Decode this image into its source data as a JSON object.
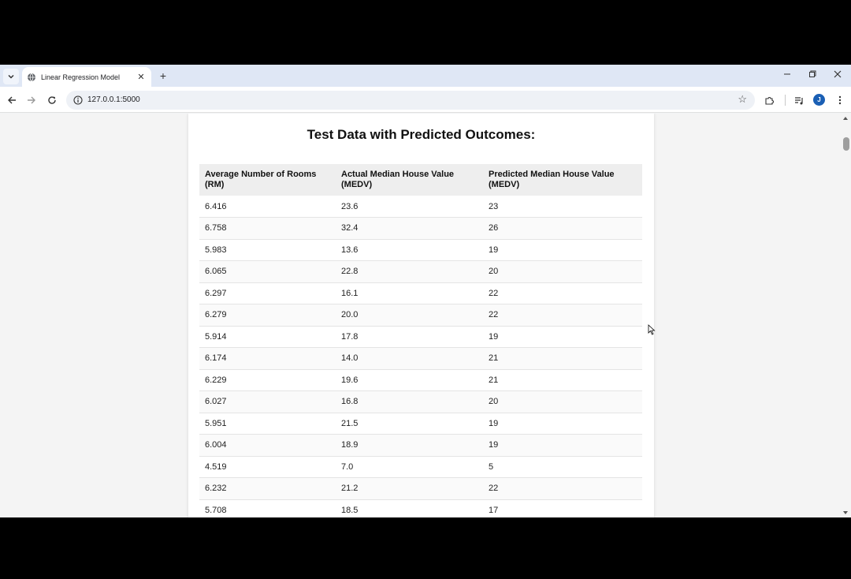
{
  "browser": {
    "tab_title": "Linear Regression Model",
    "url": "127.0.0.1:5000",
    "profile_initial": "J",
    "accent_color": "#1a5fb4"
  },
  "icons": {
    "tab_search": "chevron-down-icon",
    "new_tab": "plus-icon",
    "back": "arrow-left-icon",
    "forward": "arrow-right-icon",
    "reload": "reload-icon",
    "site_info": "info-icon",
    "bookmark": "star-icon",
    "extensions": "puzzle-icon",
    "media": "media-control-icon",
    "menu": "kebab-menu-icon"
  },
  "page": {
    "heading": "Test Data with Predicted Outcomes:",
    "table": {
      "headers": [
        "Average Number of Rooms (RM)",
        "Actual Median House Value (MEDV)",
        "Predicted Median House Value (MEDV)"
      ],
      "rows": [
        [
          "6.416",
          "23.6",
          "23"
        ],
        [
          "6.758",
          "32.4",
          "26"
        ],
        [
          "5.983",
          "13.6",
          "19"
        ],
        [
          "6.065",
          "22.8",
          "20"
        ],
        [
          "6.297",
          "16.1",
          "22"
        ],
        [
          "6.279",
          "20.0",
          "22"
        ],
        [
          "5.914",
          "17.8",
          "19"
        ],
        [
          "6.174",
          "14.0",
          "21"
        ],
        [
          "6.229",
          "19.6",
          "21"
        ],
        [
          "6.027",
          "16.8",
          "20"
        ],
        [
          "5.951",
          "21.5",
          "19"
        ],
        [
          "6.004",
          "18.9",
          "19"
        ],
        [
          "4.519",
          "7.0",
          "5"
        ],
        [
          "6.232",
          "21.2",
          "22"
        ],
        [
          "5.708",
          "18.5",
          "17"
        ]
      ]
    }
  }
}
